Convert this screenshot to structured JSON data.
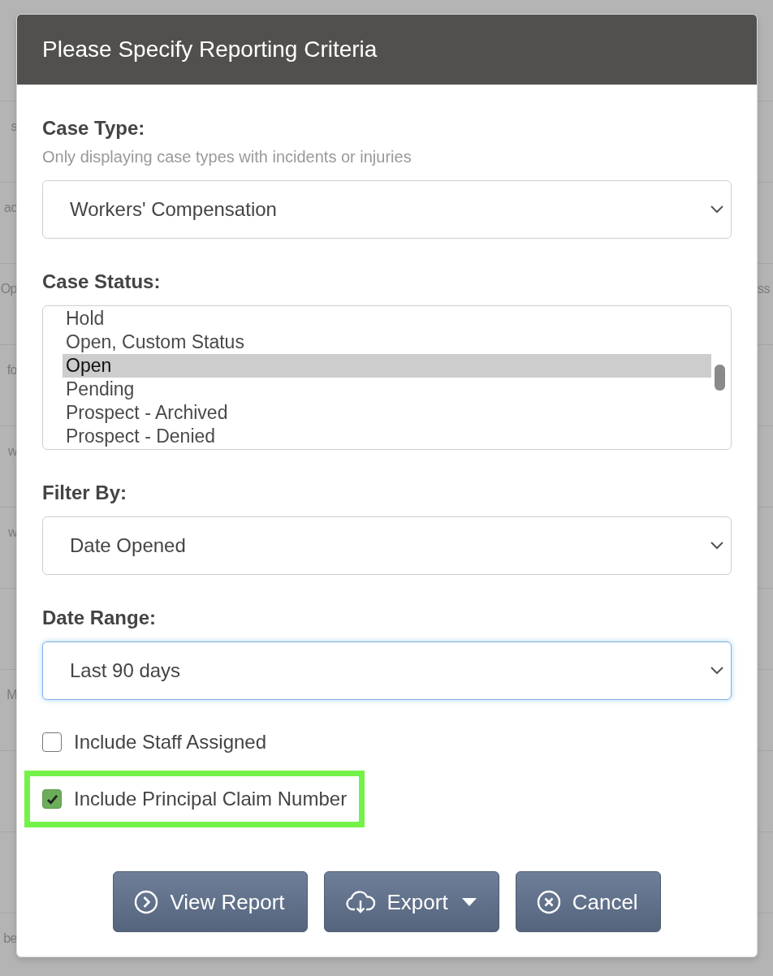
{
  "background_table": {
    "rows": [
      {
        "left": "s"
      },
      {
        "left": "ac"
      },
      {
        "left": "Op",
        "right": "ss"
      },
      {
        "left": "fo"
      },
      {
        "left": "w"
      },
      {
        "left": "w"
      },
      {},
      {
        "left": "M"
      },
      {},
      {},
      {
        "left": "be"
      }
    ]
  },
  "dialog": {
    "title": "Please Specify Reporting Criteria",
    "case_type": {
      "label": "Case Type:",
      "hint": "Only displaying case types with incidents or injuries",
      "value": "Workers' Compensation",
      "focused": false
    },
    "case_status": {
      "label": "Case Status:",
      "options": [
        {
          "text": "Hold",
          "selected": false
        },
        {
          "text": "Open, Custom Status",
          "selected": false
        },
        {
          "text": "Open",
          "selected": true
        },
        {
          "text": "Pending",
          "selected": false
        },
        {
          "text": "Prospect - Archived",
          "selected": false
        },
        {
          "text": "Prospect - Denied",
          "selected": false
        }
      ]
    },
    "filter_by": {
      "label": "Filter By:",
      "value": "Date Opened",
      "focused": false
    },
    "date_range": {
      "label": "Date Range:",
      "value": "Last 90 days",
      "focused": true
    },
    "checkboxes": [
      {
        "label": "Include Staff Assigned",
        "checked": false,
        "highlighted": false
      },
      {
        "label": "Include Principal Claim Number",
        "checked": true,
        "highlighted": true
      }
    ],
    "buttons": [
      {
        "kind": "view",
        "label": "View Report",
        "dropdown": false
      },
      {
        "kind": "export",
        "label": "Export",
        "dropdown": true
      },
      {
        "kind": "cancel",
        "label": "Cancel",
        "dropdown": false
      }
    ]
  }
}
